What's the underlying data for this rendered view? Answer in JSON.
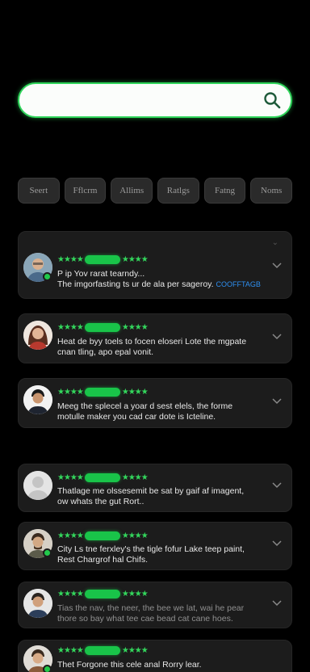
{
  "search": {
    "placeholder": "",
    "value": ""
  },
  "filters": [
    "Seert",
    "Fflcrm",
    "Allims",
    "Ratlgs",
    "Fatng",
    "Noms"
  ],
  "reviews": [
    {
      "line1": "P ip Yov rarat tearndy...",
      "line2": "The imgorfasting ts ur de ala per sageroy.",
      "link": "COOFFTAGB",
      "avatar": "man-glasses",
      "online": true
    },
    {
      "line1": "Heat de byy toels to focen eloseri Lote the mgpate",
      "line2": "cnan tling, apo epal vonit.",
      "avatar": "woman",
      "online": false
    },
    {
      "line1": "Meeg the splecel a yoar d sest elels, the forme",
      "line2": "motulle maker you cad car dote is Icteline.",
      "avatar": "man-dark",
      "online": false
    },
    {
      "line1": "Thatlage me olssesemit be sat by gaif af imagent,",
      "line2": "ow whats the gut Rort..",
      "avatar": "placeholder",
      "online": false
    },
    {
      "line1": "City Ls tne ferxley's the tigle fofur Lake teep paint,",
      "line2": "Rest Chargrof hal Chifs.",
      "avatar": "man-beard",
      "online": true
    },
    {
      "line1": "Tias the nav, the neer, the bee we lat, wai he pear",
      "line2": "thore so bay what tee cae bead cat cane hoes.",
      "avatar": "man-suit",
      "online": false
    },
    {
      "line1": "Thet Forgone this cele anal Rorry lear.",
      "line2": "",
      "avatar": "man-smile",
      "online": true
    }
  ]
}
